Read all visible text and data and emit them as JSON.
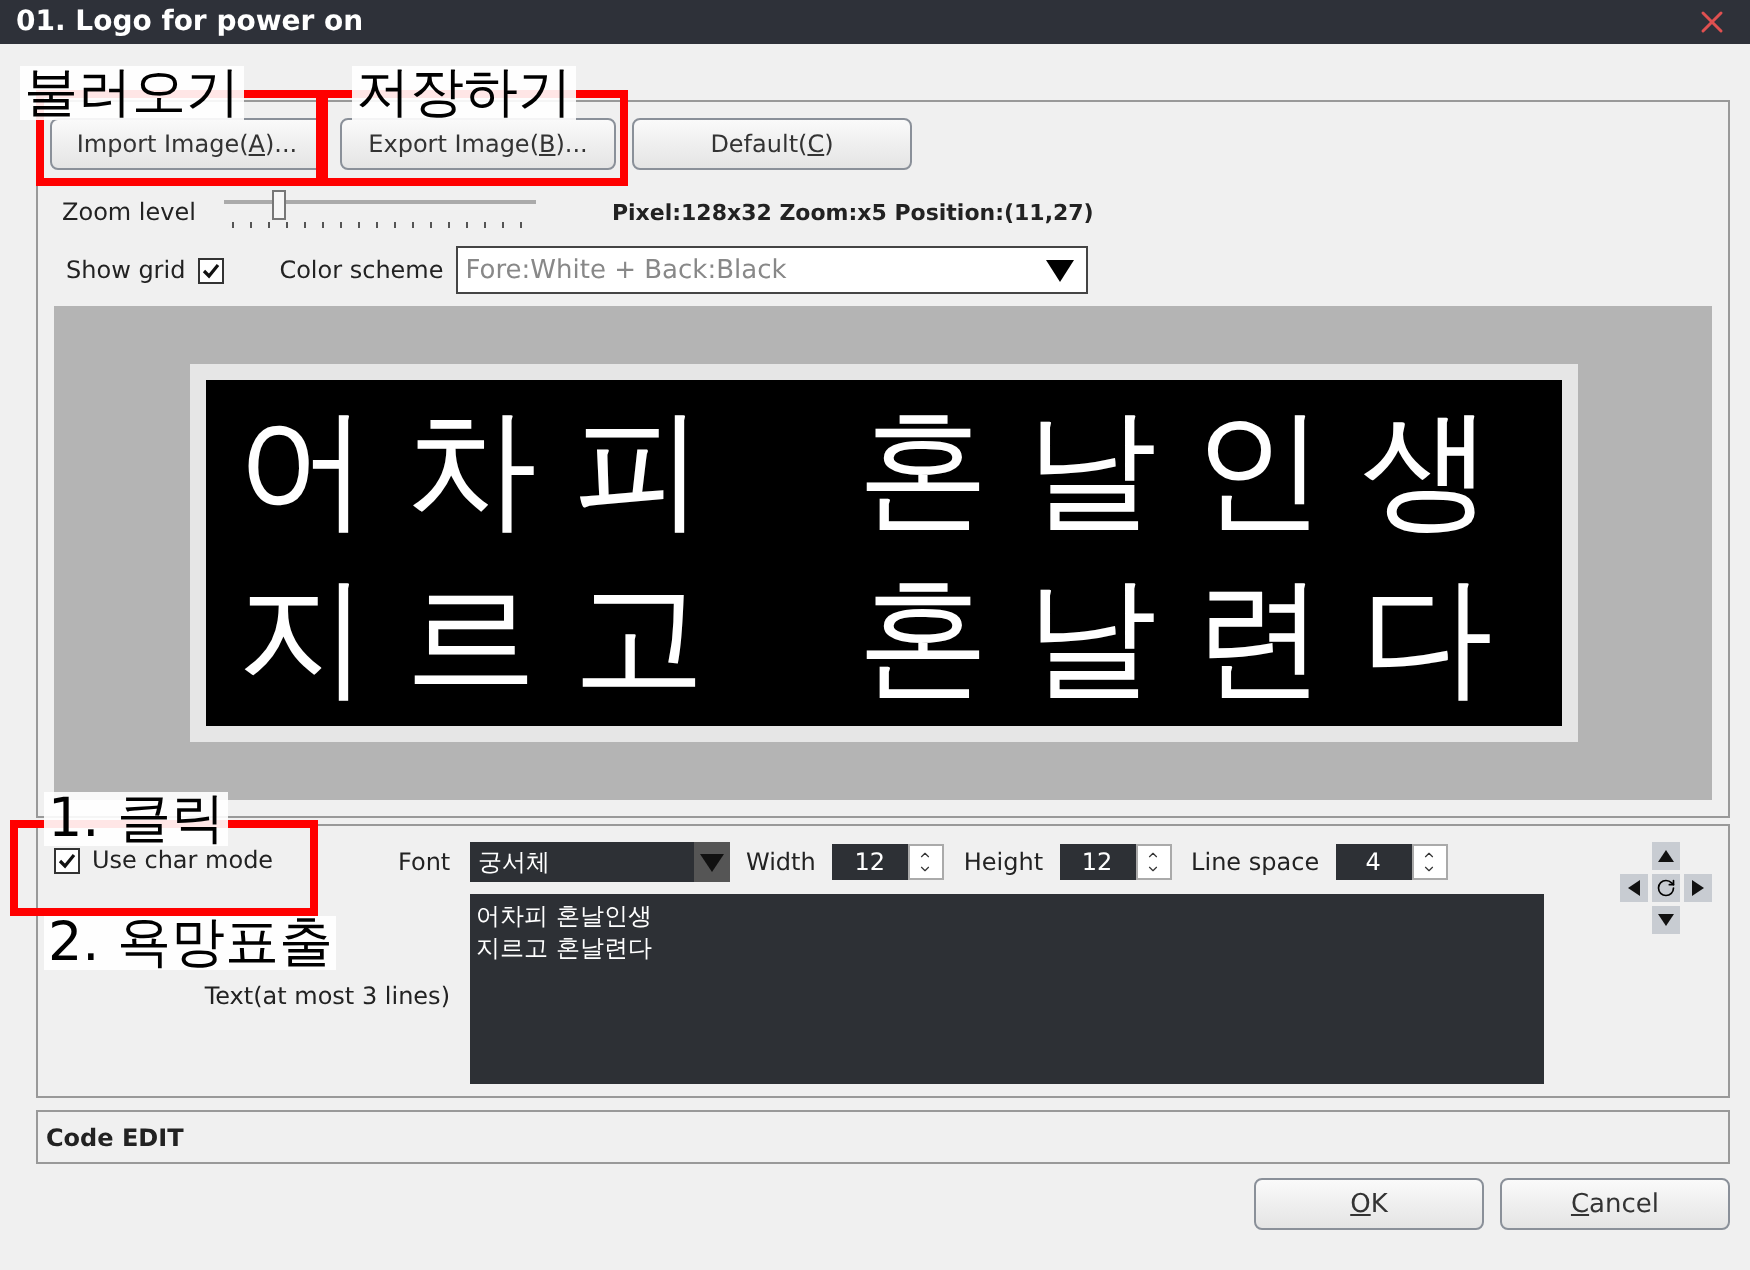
{
  "window": {
    "title": "01. Logo for power on"
  },
  "toolbar": {
    "buttons": [
      {
        "start": "Import Image(",
        "key": "A",
        "end": ")..."
      },
      {
        "start": "Export Image(",
        "key": "B",
        "end": ")..."
      },
      {
        "start": "Default(",
        "key": "C",
        "end": ")"
      }
    ]
  },
  "zoom": {
    "label": "Zoom level",
    "level": 0.17,
    "info": "Pixel:128x32  Zoom:x5  Position:(11,27)"
  },
  "show_grid": {
    "label": "Show grid",
    "checked": true
  },
  "color_scheme": {
    "label": "Color scheme",
    "value": "Fore:White + Back:Black"
  },
  "preview": {
    "lines": [
      "어차피 혼날인생",
      "지르고 혼날련다"
    ]
  },
  "char_mode": {
    "label": "Use char mode",
    "checked": true
  },
  "font": {
    "label": "Font",
    "value": "궁서체"
  },
  "spinners": [
    {
      "label": "Width",
      "value": "12"
    },
    {
      "label": "Height",
      "value": "12"
    },
    {
      "label": "Line space",
      "value": "4"
    }
  ],
  "text": {
    "label": "Text(at most 3 lines)",
    "lines": [
      "어차피 혼날인생",
      "지르고 혼날련다"
    ]
  },
  "code_edit": {
    "label": "Code EDIT"
  },
  "footer": {
    "buttons": [
      {
        "key": "O",
        "end": "K"
      },
      {
        "key": "C",
        "end": "ancel"
      }
    ]
  },
  "annotations": [
    {
      "text": "불러오기",
      "framed": true
    },
    {
      "text": "저장하기",
      "framed": true
    },
    {
      "text": "1. 클릭",
      "framed": true
    },
    {
      "text": "2. 욕망표출",
      "framed": false
    }
  ]
}
